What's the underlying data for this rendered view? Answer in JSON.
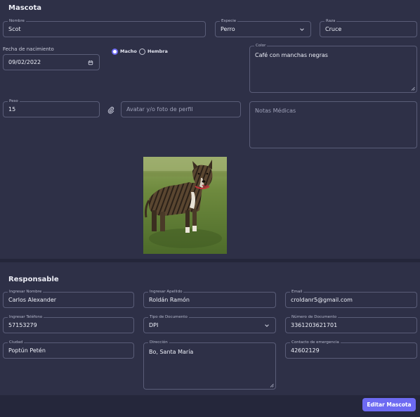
{
  "mascota": {
    "title": "Mascota",
    "nombre": {
      "label": "Nombre",
      "value": "Scot"
    },
    "especie": {
      "label": "Especie",
      "value": "Perro"
    },
    "raza": {
      "label": "Raza",
      "value": "Cruce"
    },
    "fecha": {
      "label": "Fecha de nacimiento",
      "value": "09/02/2022"
    },
    "sexo": {
      "options": [
        "Macho",
        "Hembra"
      ],
      "selected": "Macho"
    },
    "color": {
      "label": "Color",
      "value": "Café con manchas negras"
    },
    "peso": {
      "label": "Peso",
      "value": "15"
    },
    "avatar": {
      "placeholder": "Avatar y/o foto de perfil"
    },
    "notas": {
      "placeholder": "Notas Médicas"
    }
  },
  "responsable": {
    "title": "Responsable",
    "nombre": {
      "label": "Ingresar Nombre",
      "value": "Carlos Alexander"
    },
    "apellido": {
      "label": "Ingresar Apellido",
      "value": "Roldán Ramón"
    },
    "email": {
      "label": "Email",
      "value": "croldanr5@gmail.com"
    },
    "telefono": {
      "label": "Ingresar Teléfono",
      "value": "57153279"
    },
    "tipo_doc": {
      "label": "Tipo de Documento",
      "value": "DPI"
    },
    "num_doc": {
      "label": "Número de Documento",
      "value": "3361203621701"
    },
    "ciudad": {
      "label": "Ciudad",
      "value": "Poptún Petén"
    },
    "direccion": {
      "label": "Dirección",
      "value": "Bo, Santa María"
    },
    "contacto": {
      "label": "Contacto de emergencia",
      "value": "42602129"
    }
  },
  "actions": {
    "edit_label": "Editar Mascota"
  },
  "icons": {
    "select": "chevron-down-icon",
    "calendar": "calendar-icon",
    "attach": "paperclip-icon",
    "resize": "resize-handle-icon"
  },
  "colors": {
    "background": "#2e3047",
    "accent": "#6d6af2",
    "border": "#5a5d78"
  }
}
